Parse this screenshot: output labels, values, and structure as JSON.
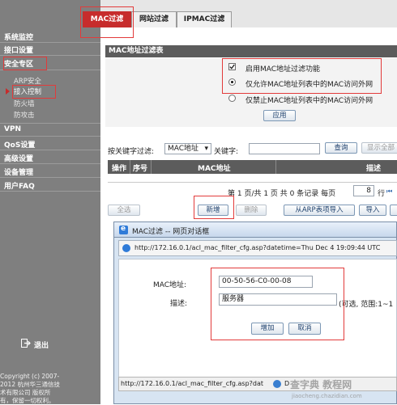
{
  "sidebar": {
    "items": [
      {
        "label": "系统监控"
      },
      {
        "label": "接口设置"
      },
      {
        "label": "安全专区"
      },
      {
        "label": "VPN"
      },
      {
        "label": "QoS设置"
      },
      {
        "label": "高级设置"
      },
      {
        "label": "设备管理"
      },
      {
        "label": "用户FAQ"
      }
    ],
    "sub_items": [
      {
        "label": "ARP安全"
      },
      {
        "label": "接入控制"
      },
      {
        "label": "防火墙"
      },
      {
        "label": "防攻击"
      }
    ],
    "logout_label": "退出",
    "copyright_lines": [
      "Copyright (c) 2007-",
      "2012  杭州华三通信技",
      "术有限公司 版权所",
      "有，保留一切权利。"
    ]
  },
  "tabs": [
    {
      "label": "MAC过滤"
    },
    {
      "label": "网站过滤"
    },
    {
      "label": "IPMAC过滤"
    }
  ],
  "mac_section": {
    "title": "MAC地址过滤表",
    "enable_label": "启用MAC地址过滤功能",
    "enable_checked": true,
    "allow_label": "仅允许MAC地址列表中的MAC访问外网",
    "deny_label": "仅禁止MAC地址列表中的MAC访问外网",
    "selected_mode": "allow",
    "apply_button": "应用"
  },
  "filter": {
    "by_label": "按关键字过滤:",
    "by_value": "MAC地址",
    "keyword_label": "关键字:",
    "keyword_value": "",
    "search_button": "查询",
    "show_all_button": "显示全部"
  },
  "table": {
    "headers": [
      "操作",
      "序号",
      "MAC地址",
      "描述"
    ]
  },
  "pagination": {
    "text": "第 1 页/共 1 页 共 0 条记录 每页",
    "per_page": "8",
    "unit": "行"
  },
  "actions": {
    "select_all": "全选",
    "add": "新增",
    "delete": "删除",
    "import_arp": "从ARP表项导入",
    "import": "导入"
  },
  "dialog": {
    "title": "MAC过滤 -- 网页对话框",
    "address": "http://172.16.0.1/acl_mac_filter_cfg.asp?datetime=Thu Dec 4 19:09:44 UTC",
    "mac_label": "MAC地址:",
    "mac_value": "00-50-56-C0-00-08",
    "desc_label": "描述:",
    "desc_value": "服务器",
    "hint": "(可选, 范围:1~1",
    "add_button": "增加",
    "cancel_button": "取消",
    "status_url": "http://172.16.0.1/acl_mac_filter_cfg.asp?dat",
    "status_tail": "D"
  },
  "watermark": {
    "line1": "查字典 教程网",
    "line2": "jiaocheng.chazidian.com"
  },
  "colors": {
    "sidebar_bg": "#7f7f7f",
    "active_tab": "#c72c2c",
    "section_title_bg": "#5c5c5c",
    "highlight_box": "#e23b3b"
  }
}
